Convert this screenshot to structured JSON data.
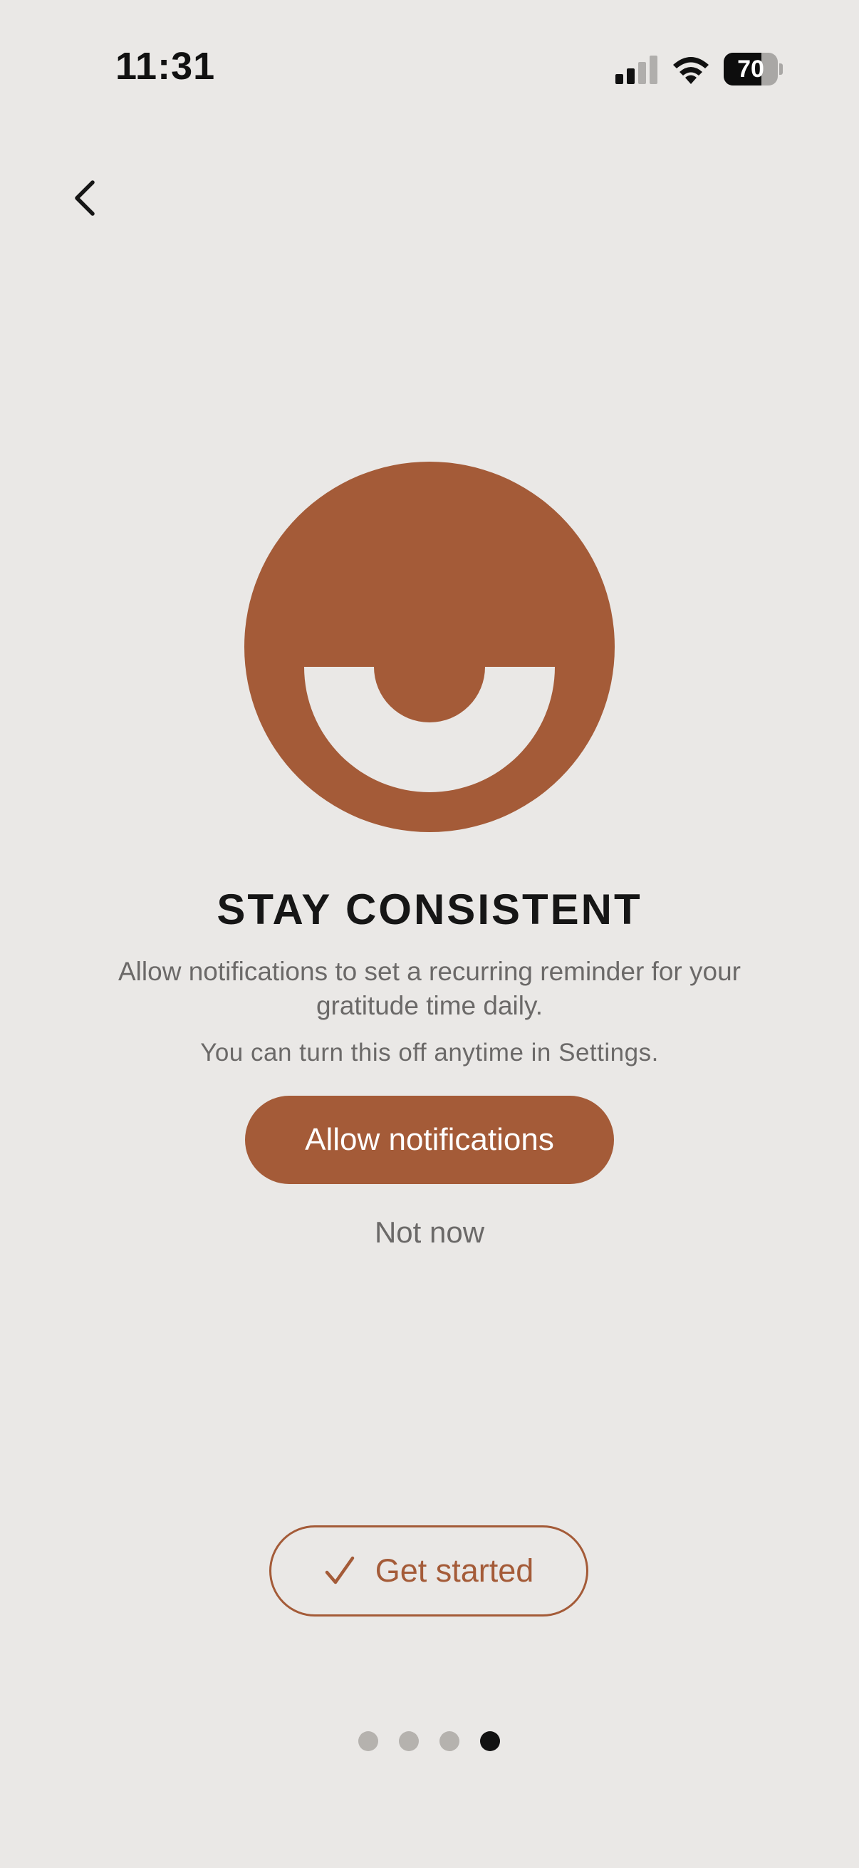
{
  "status_bar": {
    "time": "11:31",
    "battery_level": "70",
    "battery_fraction": 0.7,
    "signal_bars_active": 2,
    "signal_bars_total": 4
  },
  "icons": {
    "back": "chevron-left-icon",
    "hero": "half-smile-circle-icon",
    "check": "checkmark-icon"
  },
  "content": {
    "title": "STAY CONSISTENT",
    "description": "Allow notifications to set a recurring reminder for your gratitude time daily.",
    "settings_note": "You can turn this off anytime in Settings."
  },
  "actions": {
    "allow_label": "Allow notifications",
    "not_now_label": "Not now",
    "get_started_label": "Get started"
  },
  "pagination": {
    "total": 4,
    "current": 4
  },
  "colors": {
    "background": "#eae8e6",
    "accent": "#a45b38",
    "text_primary": "#161616",
    "text_secondary": "#6b6968",
    "dot_inactive": "#b5b2ae",
    "dot_active": "#121212"
  }
}
